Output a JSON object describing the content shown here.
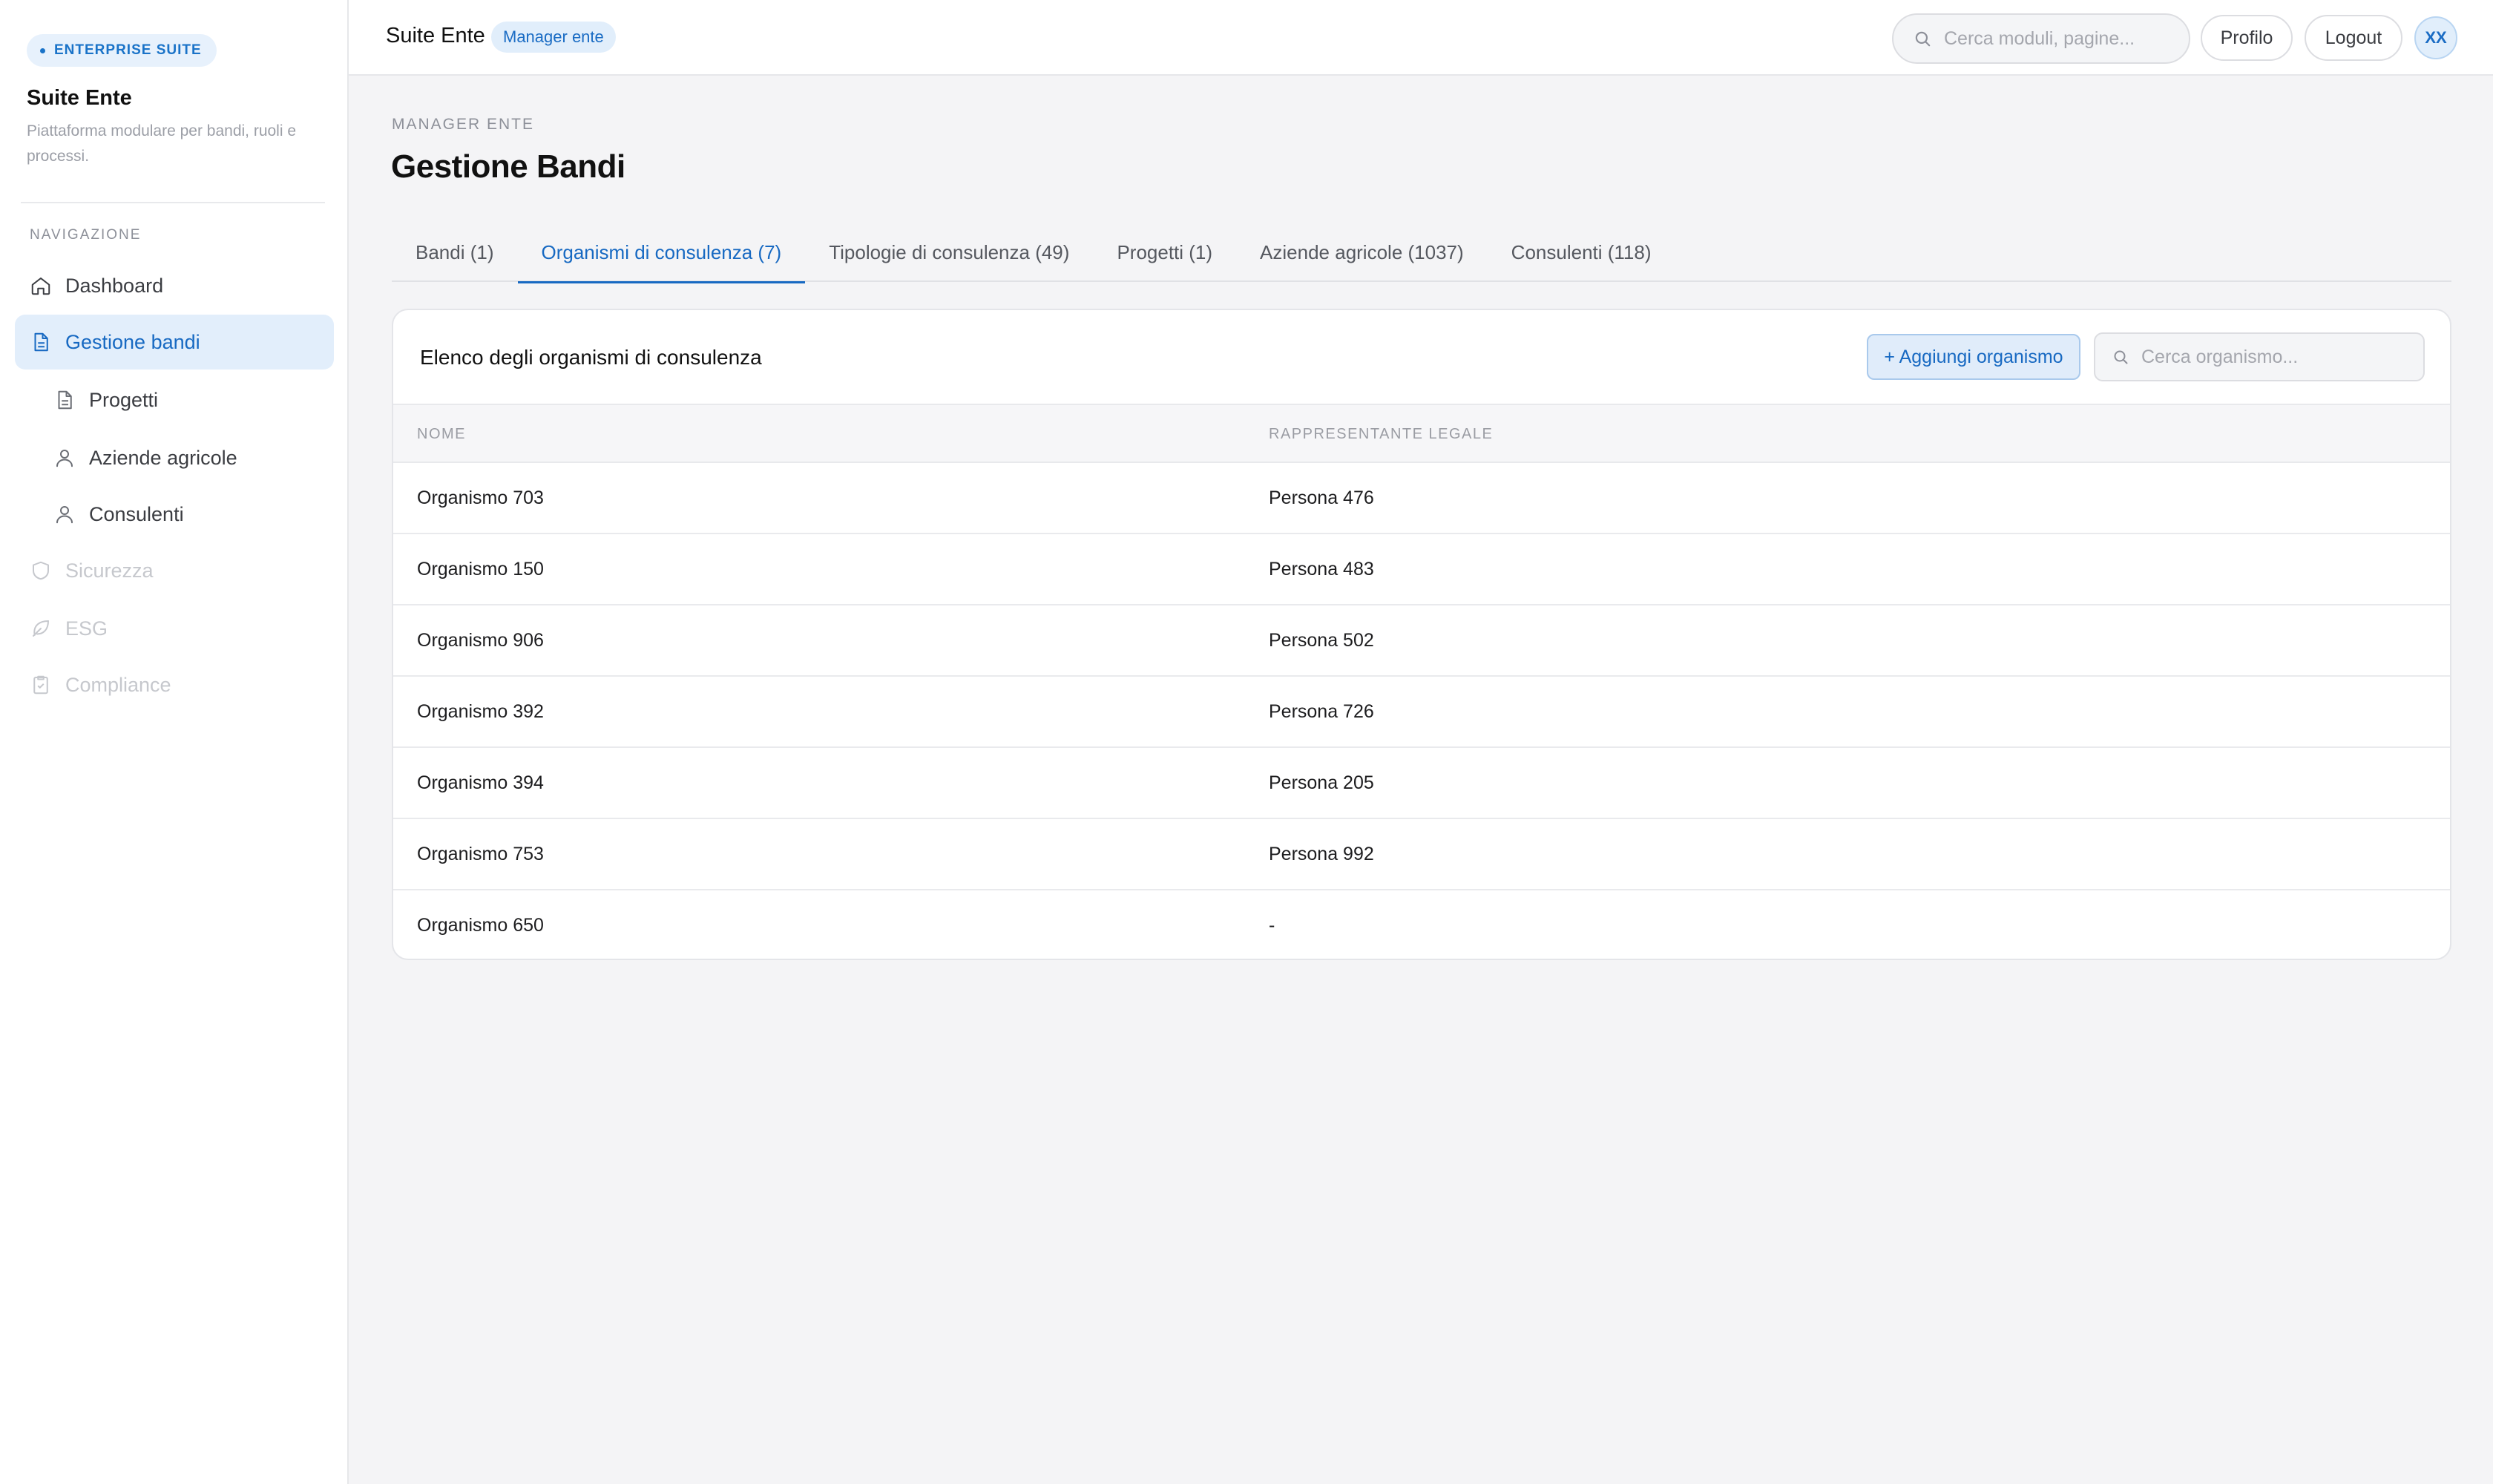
{
  "sidebar": {
    "badge": "ENTERPRISE SUITE",
    "title": "Suite Ente",
    "subtitle": "Piattaforma modulare per bandi, ruoli e processi.",
    "nav_caption": "NAVIGAZIONE",
    "items": [
      {
        "label": "Dashboard",
        "icon": "home-icon",
        "state": "normal"
      },
      {
        "label": "Gestione bandi",
        "icon": "document-icon",
        "state": "active"
      },
      {
        "label": "Progetti",
        "icon": "document-icon",
        "state": "sub"
      },
      {
        "label": "Aziende agricole",
        "icon": "user-icon",
        "state": "sub"
      },
      {
        "label": "Consulenti",
        "icon": "user-icon",
        "state": "sub"
      },
      {
        "label": "Sicurezza",
        "icon": "shield-icon",
        "state": "disabled"
      },
      {
        "label": "ESG",
        "icon": "leaf-icon",
        "state": "disabled"
      },
      {
        "label": "Compliance",
        "icon": "clipboard-icon",
        "state": "disabled"
      }
    ]
  },
  "topbar": {
    "title": "Suite Ente",
    "role": "Manager ente",
    "search_placeholder": "Cerca moduli, pagine...",
    "profile_label": "Profilo",
    "logout_label": "Logout",
    "avatar_initials": "XX"
  },
  "main": {
    "eyebrow": "MANAGER ENTE",
    "title": "Gestione Bandi",
    "tabs": [
      {
        "label": "Bandi (1)"
      },
      {
        "label": "Organismi di consulenza (7)",
        "active": true
      },
      {
        "label": "Tipologie di consulenza (49)"
      },
      {
        "label": "Progetti (1)"
      },
      {
        "label": "Aziende agricole (1037)"
      },
      {
        "label": "Consulenti (118)"
      }
    ]
  },
  "card": {
    "title": "Elenco degli organismi di consulenza",
    "add_label": "+ Aggiungi organismo",
    "search_placeholder": "Cerca organismo...",
    "columns": [
      "NOME",
      "RAPPRESENTANTE LEGALE"
    ],
    "rows": [
      [
        "Organismo 703",
        "Persona 476"
      ],
      [
        "Organismo 150",
        "Persona 483"
      ],
      [
        "Organismo 906",
        "Persona 502"
      ],
      [
        "Organismo 392",
        "Persona 726"
      ],
      [
        "Organismo 394",
        "Persona 205"
      ],
      [
        "Organismo 753",
        "Persona 992"
      ],
      [
        "Organismo 650",
        "-"
      ]
    ]
  },
  "colors": {
    "accent": "#1769c2",
    "accent_bg": "#e2eefb",
    "page_bg": "#f4f4f6"
  }
}
